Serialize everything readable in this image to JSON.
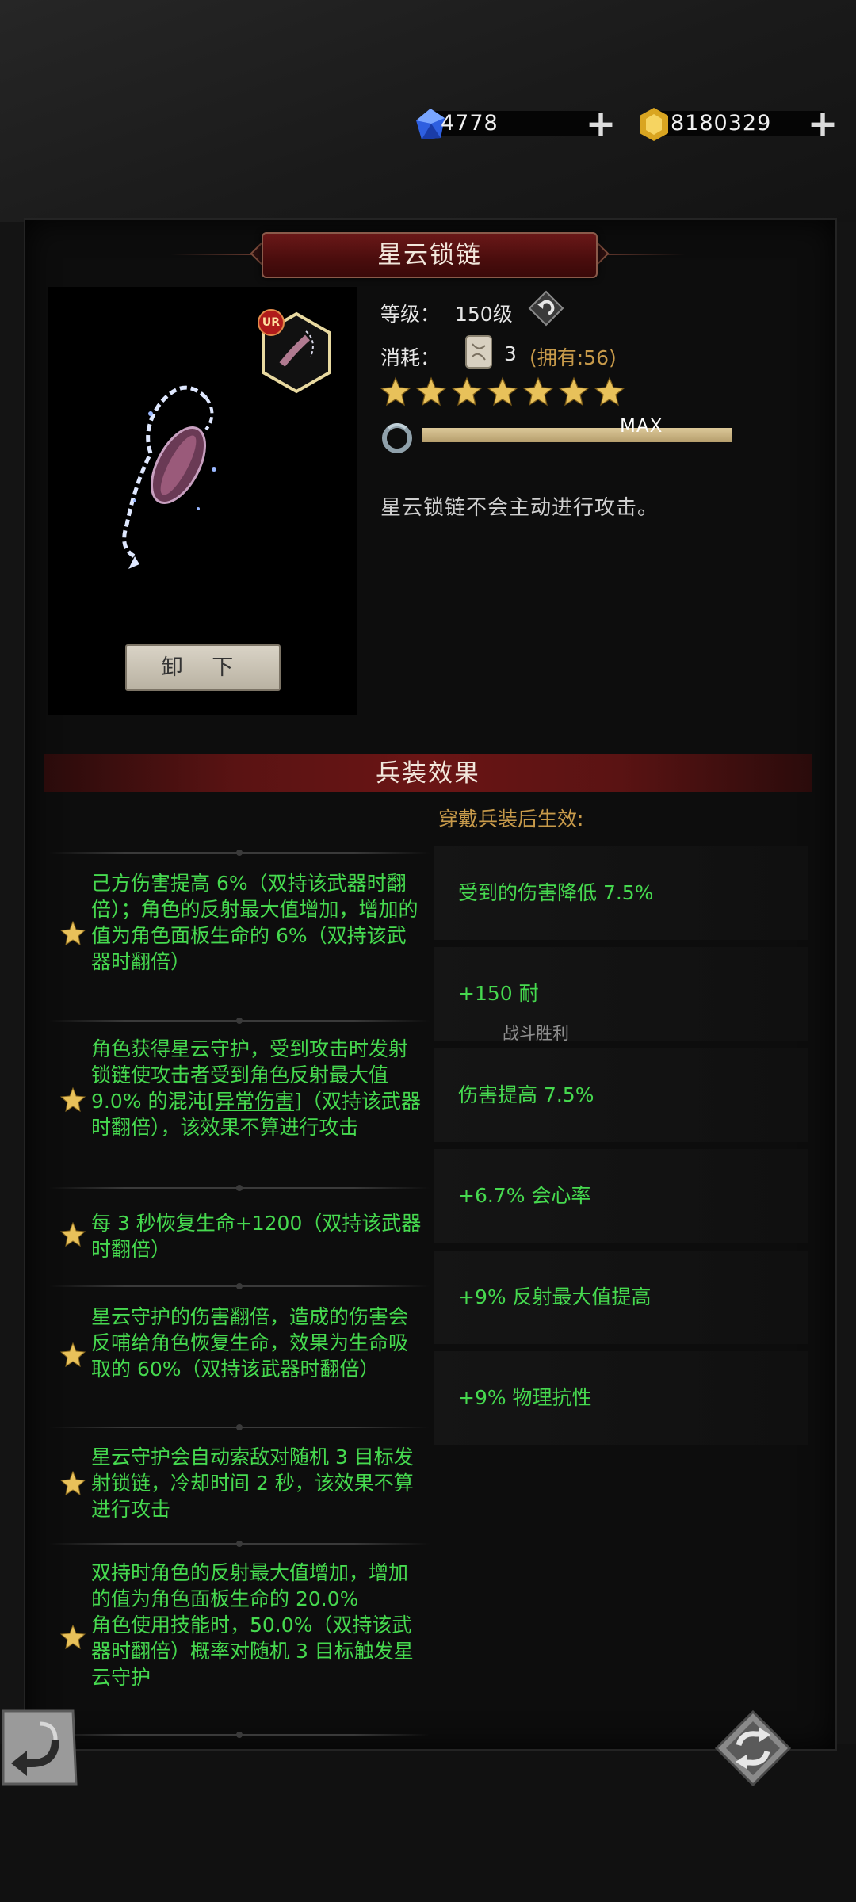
{
  "currency": {
    "gems": "4778",
    "gold": "8180329",
    "gem_icon": "blue-crystal-icon",
    "gold_icon": "gold-crystal-icon"
  },
  "item": {
    "name": "星云锁链",
    "rarity": "UR",
    "unequip_label": "卸 下",
    "level_label": "等级：",
    "level_value": "150级",
    "cost_label": "消耗：",
    "cost_amount": "3",
    "cost_owned": "(拥有:56)",
    "stars": 7,
    "progress_text": "MAX",
    "progress": 1.0,
    "description": "星云锁链不会主动进行攻击。"
  },
  "effects_header": "兵装效果",
  "wear_note": "穿戴兵装后生效:",
  "effects": [
    {
      "text": "己方伤害提高 6%（双持该武器时翻倍）；角色的反射最大值增加，增加的值为角色面板生命的 6%（双持该武器时翻倍）"
    },
    {
      "pre": "角色获得星云守护，受到攻击时发射锁链使攻击者受到角色反射最大值  9.0% 的混沌",
      "link": "[异常伤害]",
      "post": "（双持该武器时翻倍），该效果不算进行攻击"
    },
    {
      "text": "每 3 秒恢复生命+1200（双持该武器时翻倍）"
    },
    {
      "text": "星云守护的伤害翻倍，造成的伤害会反哺给角色恢复生命，效果为生命吸取的 60%（双持该武器时翻倍）"
    },
    {
      "text": "星云守护会自动索敌对随机 3 目标发射锁链，冷却时间 2 秒，该效果不算进行攻击"
    },
    {
      "line1": "双持时角色的反射最大值增加，增加的值为角色面板生命的 20.0%",
      "line2": "角色使用技能时，50.0%（双持该武器时翻倍）概率对随机 3 目标触发星云守护"
    }
  ],
  "bonuses": [
    "受到的伤害降低 7.5%",
    "+150 耐",
    "伤害提高 7.5%",
    "+6.7% 会心率",
    "+9% 反射最大值提高",
    "+9% 物理抗性"
  ],
  "battle_victory": "战斗胜利",
  "colors": {
    "effect_green": "#46d94f",
    "accent_gold": "#c79a4a",
    "title_red": "#5a1313"
  }
}
